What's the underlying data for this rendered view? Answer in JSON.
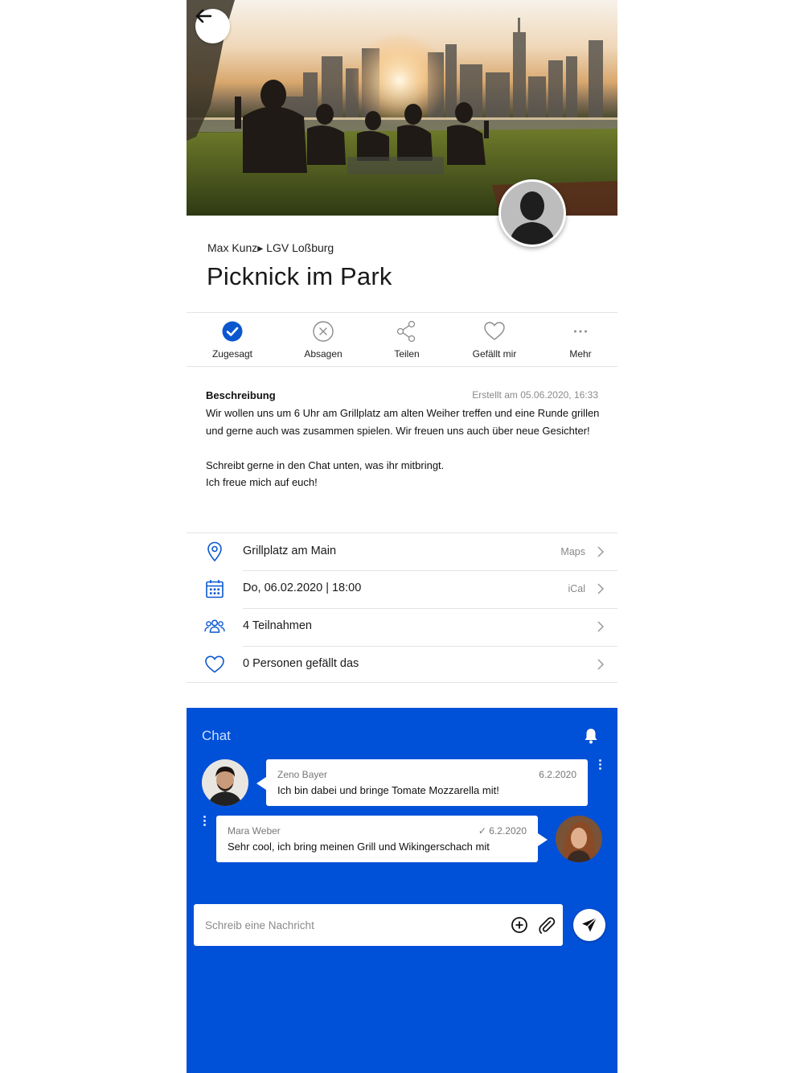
{
  "header": {
    "back_icon": "arrow-left-icon"
  },
  "event": {
    "breadcrumb": "Max Kunz▸ LGV Loßburg",
    "title": "Picknick im Park"
  },
  "actions": [
    {
      "label": "Zugesagt",
      "icon": "check-circle-icon",
      "active": true
    },
    {
      "label": "Absagen",
      "icon": "x-circle-icon"
    },
    {
      "label": "Teilen",
      "icon": "share-icon"
    },
    {
      "label": "Gefällt mir",
      "icon": "heart-icon"
    },
    {
      "label": "Mehr",
      "icon": "more-icon"
    }
  ],
  "description": {
    "heading": "Beschreibung",
    "created": "Erstellt am 05.06.2020, 16:33",
    "text": "Wir wollen uns um 6 Uhr am Grillplatz am alten Weiher treffen und eine Runde grillen und gerne auch was zusammen spielen. Wir freuen uns auch über neue Gesichter!\n\nSchreibt gerne in den Chat unten, was ihr mitbringt.\nIch freue mich auf euch!"
  },
  "info": [
    {
      "text": "Grillplatz am Main",
      "aux": "Maps",
      "icon": "location-pin-icon"
    },
    {
      "text": "Do, 06.02.2020 | 18:00",
      "aux": "iCal",
      "icon": "calendar-icon"
    },
    {
      "text": "4 Teilnahmen",
      "aux": "",
      "icon": "group-icon"
    },
    {
      "text": "0 Personen gefällt das",
      "aux": "",
      "icon": "heart-outline-icon"
    }
  ],
  "chat": {
    "title": "Chat",
    "messages": [
      {
        "name": "Zeno Bayer",
        "time": "6.2.2020",
        "text": "Ich bin dabei und bringe Tomate Mozzarella mit!"
      },
      {
        "name": "Mara Weber",
        "time": "✓ 6.2.2020",
        "text": "Sehr cool, ich bring meinen Grill und Wikingerschach mit"
      }
    ],
    "placeholder": "Schreib eine Nachricht"
  },
  "colors": {
    "accent": "#0050d8",
    "chat_bg": "#0050d8",
    "check": "#0b57d0"
  }
}
